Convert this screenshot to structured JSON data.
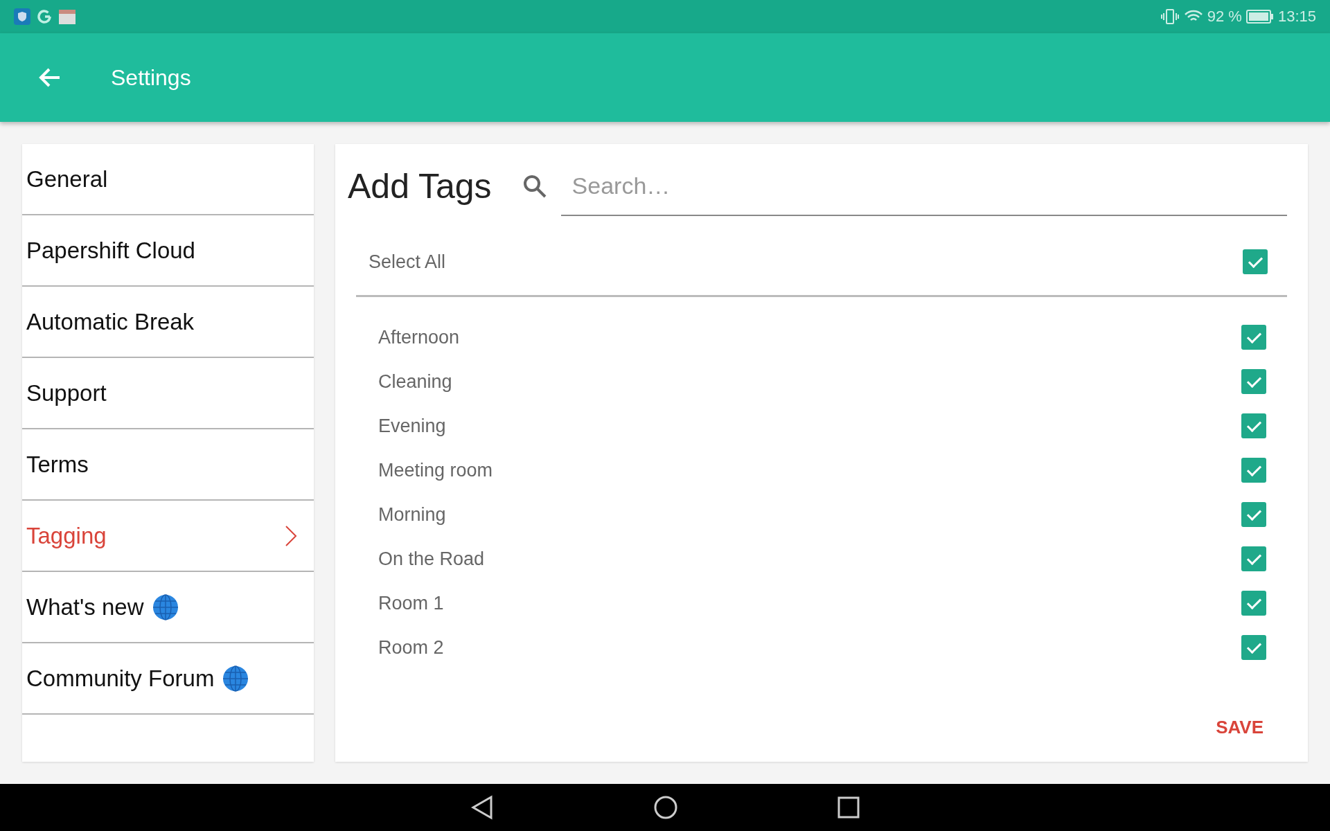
{
  "status_bar": {
    "battery_text": "92 %",
    "time": "13:15"
  },
  "app_bar": {
    "title": "Settings"
  },
  "sidebar": {
    "items": [
      {
        "label": "General",
        "kind": "page",
        "selected": false
      },
      {
        "label": "Papershift Cloud",
        "kind": "page",
        "selected": false
      },
      {
        "label": "Automatic Break",
        "kind": "page",
        "selected": false
      },
      {
        "label": "Support",
        "kind": "page",
        "selected": false
      },
      {
        "label": "Terms",
        "kind": "page",
        "selected": false
      },
      {
        "label": "Tagging",
        "kind": "page",
        "selected": true
      },
      {
        "label": "What's new",
        "kind": "web",
        "selected": false
      },
      {
        "label": "Community Forum",
        "kind": "web",
        "selected": false
      }
    ]
  },
  "panel": {
    "title": "Add Tags",
    "search": {
      "placeholder": "Search…"
    },
    "select_all": {
      "label": "Select All",
      "checked": true
    },
    "tags": [
      {
        "label": "Afternoon",
        "checked": true
      },
      {
        "label": "Cleaning",
        "checked": true
      },
      {
        "label": "Evening",
        "checked": true
      },
      {
        "label": "Meeting room",
        "checked": true
      },
      {
        "label": "Morning",
        "checked": true
      },
      {
        "label": "On the Road",
        "checked": true
      },
      {
        "label": "Room 1",
        "checked": true
      },
      {
        "label": "Room 2",
        "checked": true
      }
    ],
    "save_button": "SAVE"
  }
}
